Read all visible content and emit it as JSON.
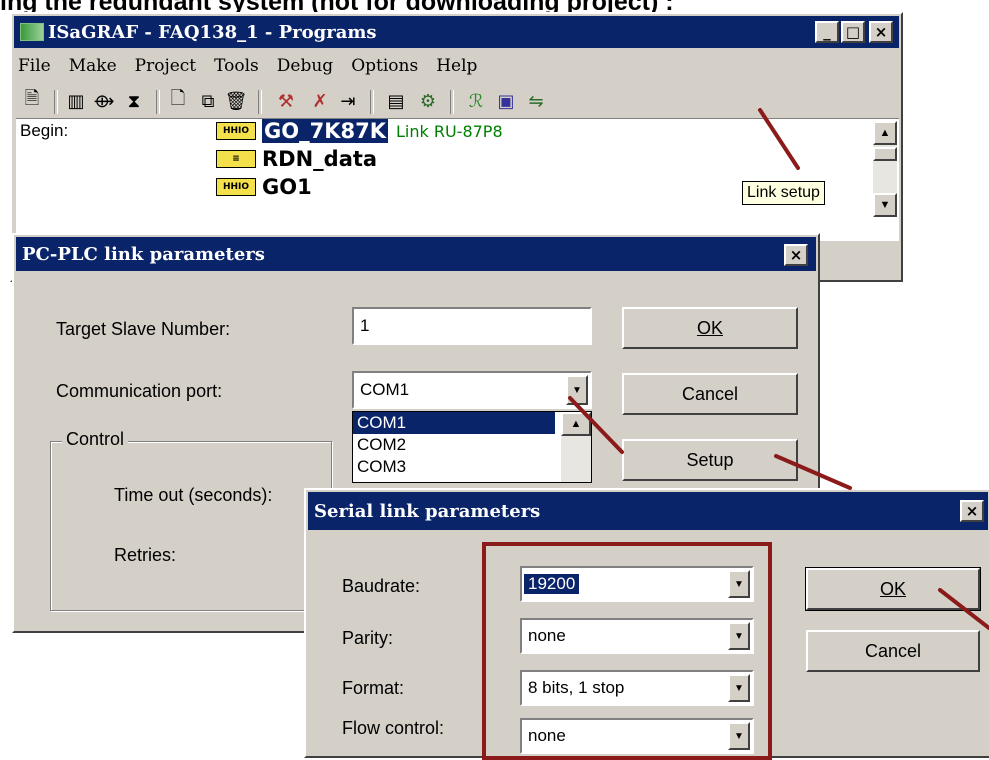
{
  "banner_text": "ing the redundant system (not for downloading project) :",
  "main_window": {
    "title": "ISaGRAF - FAQ138_1 - Programs",
    "window_buttons": [
      "_",
      "□",
      "×"
    ],
    "menu": [
      "File",
      "Make",
      "Project",
      "Tools",
      "Debug",
      "Options",
      "Help"
    ],
    "toolbar_icons": [
      "new-document-icon",
      "library-icon",
      "dictionary-icon",
      "io-connection-icon",
      "create-program-icon",
      "copy-program-icon",
      "delete-program-icon",
      "compile-icon",
      "verify-icon",
      "code-generator-icon",
      "memory-icon",
      "simulate-icon",
      "debug-icon",
      "controller-icon",
      "link-setup-icon"
    ],
    "section_label": "Begin:",
    "programs": [
      {
        "icon_text": "HHIO",
        "name": "GO_7K87K",
        "comment": "Link RU-87P8"
      },
      {
        "icon_text": "≡",
        "name": "RDN_data",
        "comment": ""
      },
      {
        "icon_text": "HHIO",
        "name": "GO1",
        "comment": ""
      }
    ],
    "tooltip": "Link setup"
  },
  "link_dialog": {
    "title": "PC-PLC link parameters",
    "target_slave_label": "Target Slave Number:",
    "target_slave_value": "1",
    "comm_port_label": "Communication port:",
    "comm_port_value": "COM1",
    "port_options": [
      "COM1",
      "COM2",
      "COM3"
    ],
    "control_group": "Control",
    "timeout_label": "Time out (seconds):",
    "retries_label": "Retries:",
    "ok": "OK",
    "cancel": "Cancel",
    "setup": "Setup"
  },
  "serial_dialog": {
    "title": "Serial link parameters",
    "baudrate_label": "Baudrate:",
    "baudrate_value": "19200",
    "parity_label": "Parity:",
    "parity_value": "none",
    "format_label": "Format:",
    "format_value": "8 bits, 1 stop",
    "flow_label": "Flow control:",
    "flow_value": "none",
    "ok": "OK",
    "cancel": "Cancel"
  },
  "colors": {
    "titlebar": "#0a246a",
    "annotation": "#8b1a1a",
    "comment_green": "#008000"
  }
}
